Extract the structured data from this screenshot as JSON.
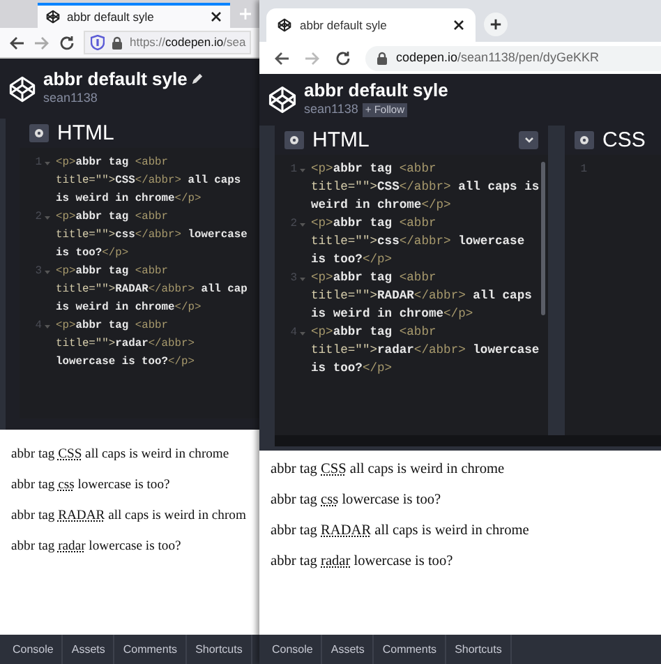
{
  "windows": [
    {
      "kind": "firefox",
      "tab": {
        "title": "abbr default syle"
      },
      "url": {
        "scheme": "https://",
        "host": "codepen.io",
        "path": "/sea"
      },
      "pen": {
        "title": "abbr default syle",
        "author": "sean1138"
      },
      "panels": [
        {
          "title": "HTML",
          "lines": [
            {
              "number": "1",
              "rows": [
                [
                  {
                    "kind": "tag",
                    "text": "<p>"
                  },
                  {
                    "kind": "text",
                    "text": "abbr tag "
                  },
                  {
                    "kind": "tag",
                    "text": "<abbr"
                  }
                ],
                [
                  {
                    "kind": "attr",
                    "text": "title=\"\">"
                  },
                  {
                    "kind": "text",
                    "text": "CSS"
                  },
                  {
                    "kind": "tag",
                    "text": "</abbr>"
                  },
                  {
                    "kind": "text",
                    "text": " all caps"
                  }
                ],
                [
                  {
                    "kind": "text",
                    "text": "is weird in chrome"
                  },
                  {
                    "kind": "tag",
                    "text": "</p>"
                  }
                ]
              ]
            },
            {
              "number": "2",
              "rows": [
                [
                  {
                    "kind": "tag",
                    "text": "<p>"
                  },
                  {
                    "kind": "text",
                    "text": "abbr tag "
                  },
                  {
                    "kind": "tag",
                    "text": "<abbr"
                  }
                ],
                [
                  {
                    "kind": "attr",
                    "text": "title=\"\">"
                  },
                  {
                    "kind": "text",
                    "text": "css"
                  },
                  {
                    "kind": "tag",
                    "text": "</abbr>"
                  },
                  {
                    "kind": "text",
                    "text": " lowercase"
                  }
                ],
                [
                  {
                    "kind": "text",
                    "text": "is too?"
                  },
                  {
                    "kind": "tag",
                    "text": "</p>"
                  }
                ]
              ]
            },
            {
              "number": "3",
              "rows": [
                [
                  {
                    "kind": "tag",
                    "text": "<p>"
                  },
                  {
                    "kind": "text",
                    "text": "abbr tag "
                  },
                  {
                    "kind": "tag",
                    "text": "<abbr"
                  }
                ],
                [
                  {
                    "kind": "attr",
                    "text": "title=\"\">"
                  },
                  {
                    "kind": "text",
                    "text": "RADAR"
                  },
                  {
                    "kind": "tag",
                    "text": "</abbr>"
                  },
                  {
                    "kind": "text",
                    "text": " all cap"
                  }
                ],
                [
                  {
                    "kind": "text",
                    "text": "is weird in chrome"
                  },
                  {
                    "kind": "tag",
                    "text": "</p>"
                  }
                ]
              ]
            },
            {
              "number": "4",
              "rows": [
                [
                  {
                    "kind": "tag",
                    "text": "<p>"
                  },
                  {
                    "kind": "text",
                    "text": "abbr tag "
                  },
                  {
                    "kind": "tag",
                    "text": "<abbr"
                  }
                ],
                [
                  {
                    "kind": "attr",
                    "text": "title=\"\">"
                  },
                  {
                    "kind": "text",
                    "text": "radar"
                  },
                  {
                    "kind": "tag",
                    "text": "</abbr>"
                  }
                ],
                [
                  {
                    "kind": "text",
                    "text": "lowercase is too?"
                  },
                  {
                    "kind": "tag",
                    "text": "</p>"
                  }
                ]
              ]
            }
          ]
        }
      ],
      "preview": [
        {
          "before": "abbr tag ",
          "abbr": "CSS",
          "after": " all caps is weird in chrome"
        },
        {
          "before": "abbr tag ",
          "abbr": "css",
          "after": " lowercase is too?"
        },
        {
          "before": "abbr tag ",
          "abbr": "RADAR",
          "after": " all caps is weird in chrom"
        },
        {
          "before": "abbr tag ",
          "abbr": "radar",
          "after": " lowercase is too?"
        }
      ],
      "footer": [
        "Console",
        "Assets",
        "Comments",
        "Shortcuts"
      ]
    },
    {
      "kind": "chrome",
      "tab": {
        "title": "abbr default syle"
      },
      "url": {
        "host": "codepen.io",
        "path": "/sean1138/pen/dyGeKKR"
      },
      "pen": {
        "title": "abbr default syle",
        "author": "sean1138",
        "follow": "+ Follow"
      },
      "panels": [
        {
          "title": "HTML",
          "lines": [
            {
              "number": "1",
              "rows": [
                [
                  {
                    "kind": "tag",
                    "text": "<p>"
                  },
                  {
                    "kind": "text",
                    "text": "abbr tag "
                  },
                  {
                    "kind": "tag",
                    "text": "<abbr"
                  }
                ],
                [
                  {
                    "kind": "attr",
                    "text": "title=\"\">"
                  },
                  {
                    "kind": "text",
                    "text": "CSS"
                  },
                  {
                    "kind": "tag",
                    "text": "</abbr>"
                  },
                  {
                    "kind": "text",
                    "text": " all caps is"
                  }
                ],
                [
                  {
                    "kind": "text",
                    "text": "weird in chrome"
                  },
                  {
                    "kind": "tag",
                    "text": "</p>"
                  }
                ]
              ]
            },
            {
              "number": "2",
              "rows": [
                [
                  {
                    "kind": "tag",
                    "text": "<p>"
                  },
                  {
                    "kind": "text",
                    "text": "abbr tag "
                  },
                  {
                    "kind": "tag",
                    "text": "<abbr"
                  }
                ],
                [
                  {
                    "kind": "attr",
                    "text": "title=\"\">"
                  },
                  {
                    "kind": "text",
                    "text": "css"
                  },
                  {
                    "kind": "tag",
                    "text": "</abbr>"
                  },
                  {
                    "kind": "text",
                    "text": " lowercase"
                  }
                ],
                [
                  {
                    "kind": "text",
                    "text": "is too?"
                  },
                  {
                    "kind": "tag",
                    "text": "</p>"
                  }
                ]
              ]
            },
            {
              "number": "3",
              "rows": [
                [
                  {
                    "kind": "tag",
                    "text": "<p>"
                  },
                  {
                    "kind": "text",
                    "text": "abbr tag "
                  },
                  {
                    "kind": "tag",
                    "text": "<abbr"
                  }
                ],
                [
                  {
                    "kind": "attr",
                    "text": "title=\"\">"
                  },
                  {
                    "kind": "text",
                    "text": "RADAR"
                  },
                  {
                    "kind": "tag",
                    "text": "</abbr>"
                  },
                  {
                    "kind": "text",
                    "text": " all caps"
                  }
                ],
                [
                  {
                    "kind": "text",
                    "text": "is weird in chrome"
                  },
                  {
                    "kind": "tag",
                    "text": "</p>"
                  }
                ]
              ]
            },
            {
              "number": "4",
              "rows": [
                [
                  {
                    "kind": "tag",
                    "text": "<p>"
                  },
                  {
                    "kind": "text",
                    "text": "abbr tag "
                  },
                  {
                    "kind": "tag",
                    "text": "<abbr"
                  }
                ],
                [
                  {
                    "kind": "attr",
                    "text": "title=\"\">"
                  },
                  {
                    "kind": "text",
                    "text": "radar"
                  },
                  {
                    "kind": "tag",
                    "text": "</abbr>"
                  },
                  {
                    "kind": "text",
                    "text": " lowercase"
                  }
                ],
                [
                  {
                    "kind": "text",
                    "text": "is too?"
                  },
                  {
                    "kind": "tag",
                    "text": "</p>"
                  }
                ]
              ]
            }
          ]
        },
        {
          "title": "CSS",
          "lines": [
            {
              "number": "1"
            }
          ]
        }
      ],
      "preview": [
        {
          "before": "abbr tag ",
          "abbr": "CSS",
          "after": " all caps is weird in chrome"
        },
        {
          "before": "abbr tag ",
          "abbr": "css",
          "after": " lowercase is too?"
        },
        {
          "before": "abbr tag ",
          "abbr": "RADAR",
          "after": " all caps is weird in chrome"
        },
        {
          "before": "abbr tag ",
          "abbr": "radar",
          "after": " lowercase is too?"
        }
      ],
      "footer": [
        "Console",
        "Assets",
        "Comments",
        "Shortcuts"
      ]
    }
  ]
}
